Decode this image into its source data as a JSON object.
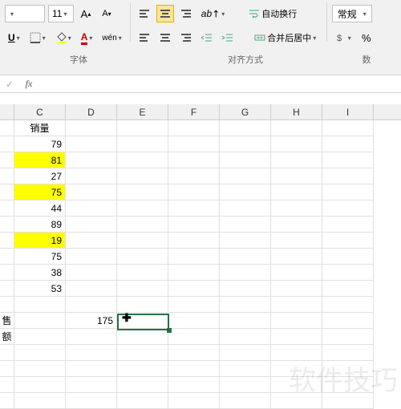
{
  "ribbon": {
    "font_size": "11",
    "wen": "wén",
    "wrap_text": "自动换行",
    "merge_center": "合并后居中",
    "number_format": "常规",
    "group_font": "字体",
    "group_align": "对齐方式",
    "group_num": "数"
  },
  "fx": {
    "label": "fx"
  },
  "columns": [
    "C",
    "D",
    "E",
    "F",
    "G",
    "H",
    "I"
  ],
  "header_c": "销量",
  "data_c": [
    {
      "v": "79",
      "hl": false
    },
    {
      "v": "81",
      "hl": true
    },
    {
      "v": "27",
      "hl": false
    },
    {
      "v": "75",
      "hl": true
    },
    {
      "v": "44",
      "hl": false
    },
    {
      "v": "89",
      "hl": false
    },
    {
      "v": "19",
      "hl": true
    },
    {
      "v": "75",
      "hl": false
    },
    {
      "v": "38",
      "hl": false
    },
    {
      "v": "53",
      "hl": false
    }
  ],
  "row_label": "售额",
  "d_value": "175",
  "watermark": "软件技巧"
}
